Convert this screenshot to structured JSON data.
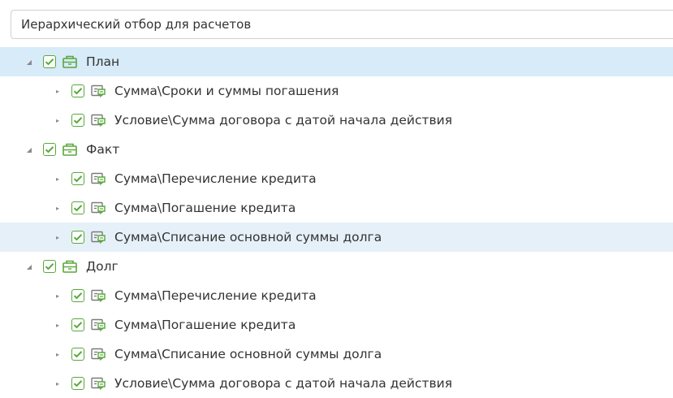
{
  "header": {
    "title": "Иерархический отбор для расчетов"
  },
  "colors": {
    "accent_green": "#58a83a",
    "selected_row": "#d7ebf9",
    "hover_row": "#e6f0f8"
  },
  "icons": {
    "group": "folder-box-icon",
    "item": "chat-card-icon",
    "collapse": "triangle-down-icon",
    "expand": "triangle-right-icon"
  },
  "tree": [
    {
      "label": "План",
      "checked": true,
      "expanded": true,
      "children": [
        {
          "label": "Сумма\\Сроки и суммы погашения",
          "checked": true
        },
        {
          "label": "Условие\\Сумма договора с датой начала действия",
          "checked": true
        }
      ]
    },
    {
      "label": "Факт",
      "checked": true,
      "expanded": true,
      "children": [
        {
          "label": "Сумма\\Перечисление кредита",
          "checked": true
        },
        {
          "label": "Сумма\\Погашение кредита",
          "checked": true
        },
        {
          "label": "Сумма\\Списание основной суммы долга",
          "checked": true
        }
      ]
    },
    {
      "label": "Долг",
      "checked": true,
      "expanded": true,
      "children": [
        {
          "label": "Сумма\\Перечисление кредита",
          "checked": true
        },
        {
          "label": "Сумма\\Погашение кредита",
          "checked": true
        },
        {
          "label": "Сумма\\Списание основной суммы долга",
          "checked": true
        },
        {
          "label": "Условие\\Сумма договора с датой начала действия",
          "checked": true
        }
      ]
    }
  ]
}
